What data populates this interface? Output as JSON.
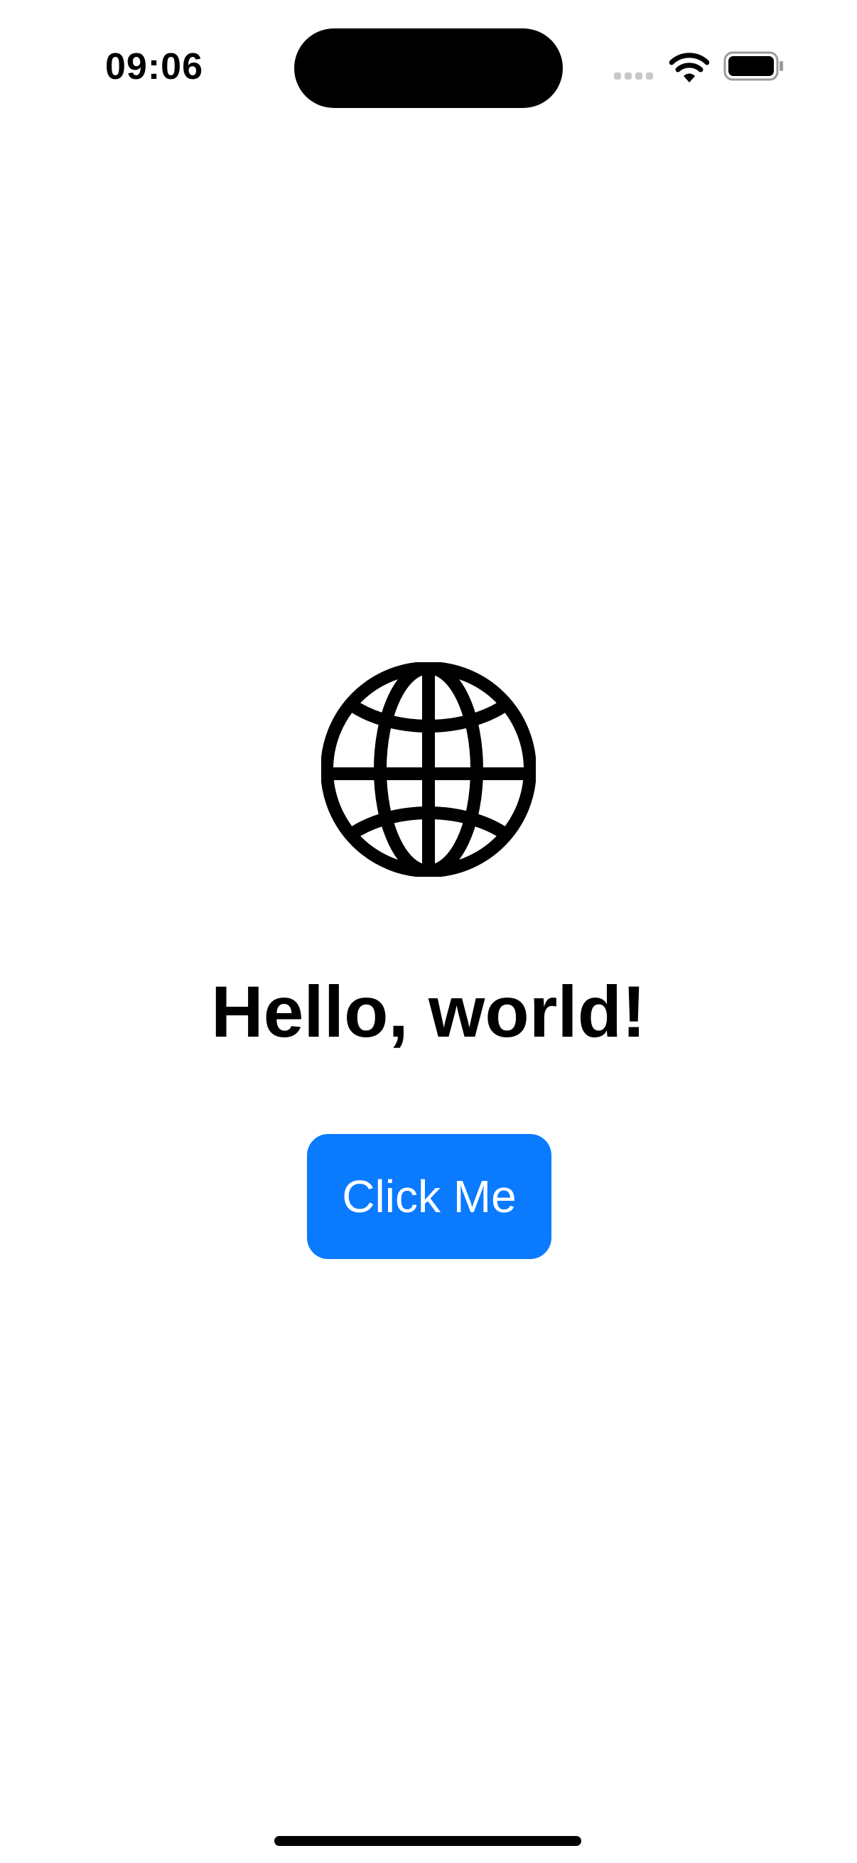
{
  "status_bar": {
    "time": "09:06",
    "icons": [
      "signal-icon",
      "wifi-icon",
      "battery-icon"
    ]
  },
  "main": {
    "icon": "globe-icon",
    "title": "Hello, world!",
    "button_label": "Click Me"
  },
  "colors": {
    "accent": "#0a7aff",
    "text": "#000000",
    "background": "#ffffff"
  }
}
